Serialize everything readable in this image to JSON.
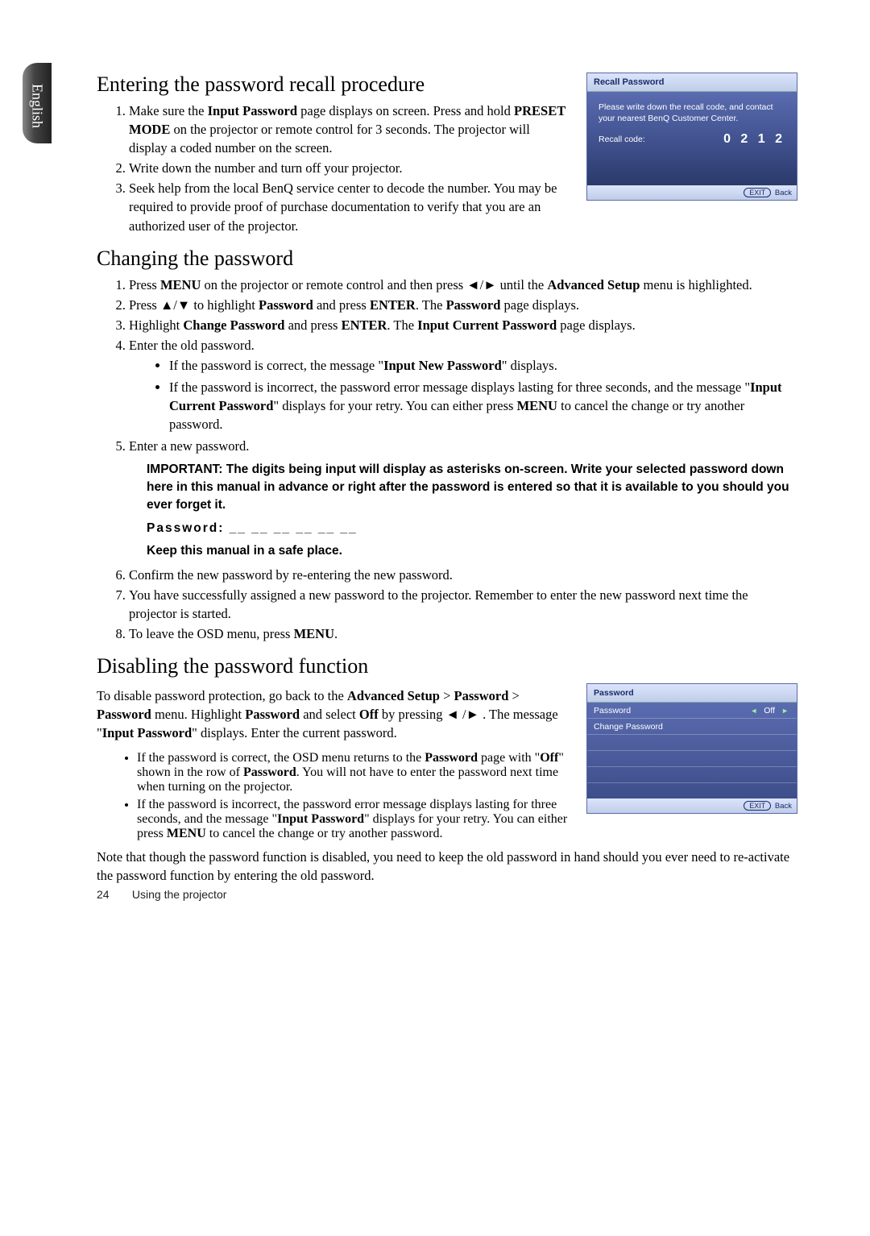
{
  "sideTab": "English",
  "section1": {
    "title": "Entering the password recall procedure",
    "steps": {
      "s1a": "Make sure the ",
      "s1b": "Input Password",
      "s1c": " page displays on screen. Press and hold ",
      "s1d": "PRESET MODE",
      "s1e": " on the projector or remote control for 3 seconds. The projector will display a coded number on the screen.",
      "s2": "Write down the number and turn off your projector.",
      "s3": "Seek help from the local BenQ service center to decode the number. You may be required to provide proof of purchase documentation to verify that you are an authorized user of the projector."
    },
    "osd": {
      "title": "Recall Password",
      "info": "Please write down the recall code, and contact your nearest BenQ Customer Center.",
      "recallLabel": "Recall code:",
      "recallCode": "0 2 1 2",
      "exit": "EXIT",
      "back": "Back"
    }
  },
  "section2": {
    "title": "Changing the password",
    "steps": {
      "s1a": "Press ",
      "s1b": "MENU",
      "s1c": " on the projector or remote control and then press ◄/► until the ",
      "s1d": "Advanced Setup",
      "s1e": " menu is highlighted.",
      "s2a": "Press ▲/▼ to highlight ",
      "s2b": "Password",
      "s2c": " and press ",
      "s2d": "ENTER",
      "s2e": ". The ",
      "s2f": "Password",
      "s2g": " page displays.",
      "s3a": "Highlight ",
      "s3b": "Change Password",
      "s3c": " and press ",
      "s3d": "ENTER",
      "s3e": ". The ",
      "s3f": "Input Current Password",
      "s3g": " page displays.",
      "s4": "Enter the old password.",
      "s4b1a": "If the password is correct, the message \"",
      "s4b1b": "Input New Password",
      "s4b1c": "\" displays.",
      "s4b2a": "If the password is incorrect, the password error message displays lasting for three seconds, and the message \"",
      "s4b2b": "Input Current Password",
      "s4b2c": "\" displays for your retry. You can either press ",
      "s4b2d": "MENU",
      "s4b2e": " to cancel the change or try another password.",
      "s5": "Enter a new password.",
      "important": "IMPORTANT: The digits being input will display as asterisks on-screen. Write your selected password down here in this manual in advance or right after the password is entered so that it is available to you should you ever forget it.",
      "pwLabel": "Password: __ __ __ __ __ __",
      "keep": "Keep this manual in a safe place.",
      "s6": "Confirm the new password by re-entering the new password.",
      "s7": "You have successfully assigned a new password to the projector. Remember to enter the new password next time the projector is started.",
      "s8a": "To leave the OSD menu, press ",
      "s8b": "MENU",
      "s8c": "."
    }
  },
  "section3": {
    "title": "Disabling the password function",
    "intro": {
      "a": "To disable password protection, go back to the ",
      "b": "Advanced Setup",
      "c": " > ",
      "d": "Password",
      "e": " > ",
      "f": "Password",
      "g": " menu. Highlight ",
      "h": "Password",
      "i": " and select ",
      "j": "Off",
      "k": " by pressing ◄ /► . The message \"",
      "l": "Input Password",
      "m": "\" displays. Enter the current password."
    },
    "bullets": {
      "b1a": "If the password is correct, the OSD menu returns to the ",
      "b1b": "Password",
      "b1c": " page with \"",
      "b1d": "Off",
      "b1e": "\" shown in the row of ",
      "b1f": "Password",
      "b1g": ". You will not have to enter the password next time when turning on the projector.",
      "b2a": "If the password is incorrect, the password error message displays lasting for three seconds, and the message \"",
      "b2b": "Input Password",
      "b2c": "\" displays for your retry. You can either press ",
      "b2d": "MENU",
      "b2e": " to cancel the change or try another password."
    },
    "note": "Note that though the password function is disabled, you need to keep the old password in hand should you ever need to re-activate the password function by entering the old password.",
    "osd": {
      "title": "Password",
      "rowPassword": "Password",
      "rowChange": "Change Password",
      "off": "Off",
      "exit": "EXIT",
      "back": "Back"
    }
  },
  "footer": {
    "page": "24",
    "label": "Using the projector"
  }
}
